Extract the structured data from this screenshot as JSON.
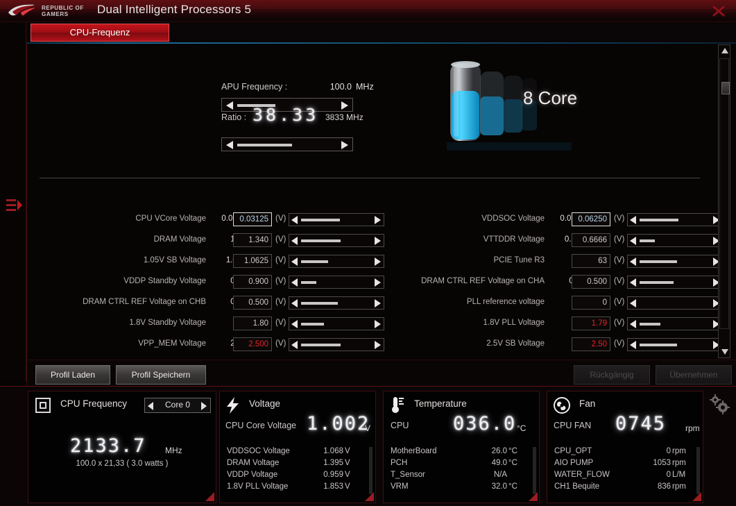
{
  "window": {
    "brand_line1": "REPUBLIC OF",
    "brand_line2": "GAMERS",
    "title": "Dual Intelligent Processors 5",
    "close_icon": "close-icon",
    "accent_red": "#b31118",
    "accent_cyan": "#1d6f9e"
  },
  "rail": {
    "toggle_icon": "menu-expand-icon"
  },
  "tabs": [
    {
      "label": "CPU-Frequenz",
      "active": true
    }
  ],
  "frequency": {
    "apu_label": "APU Frequency :",
    "apu_value": "100.0",
    "apu_unit": "MHz",
    "ratio_label": "Ratio :",
    "ratio_value": "38.33",
    "ratio_mhz": "3833 MHz",
    "apu_slider_fill_pct": 38,
    "ratio_slider_fill_pct": 54
  },
  "cores": {
    "count_label": "8 Core"
  },
  "voltage_rows_left": [
    {
      "name": "CPU VCore Voltage",
      "current": "0.03125",
      "value": "0.03125",
      "unit": "(V)",
      "focused": true,
      "red": false,
      "fill_pct": 52
    },
    {
      "name": "DRAM Voltage",
      "current": "1.340",
      "value": "1.340",
      "unit": "(V)",
      "focused": false,
      "red": false,
      "fill_pct": 53
    },
    {
      "name": "1.05V SB Voltage",
      "current": "1.0625",
      "value": "1.0625",
      "unit": "(V)",
      "focused": false,
      "red": false,
      "fill_pct": 36
    },
    {
      "name": "VDDP Standby Voltage",
      "current": "0.900",
      "value": "0.900",
      "unit": "(V)",
      "focused": false,
      "red": false,
      "fill_pct": 20
    },
    {
      "name": "DRAM CTRL REF Voltage on CHB",
      "current": "0.500",
      "value": "0.500",
      "unit": "(V)",
      "focused": false,
      "red": false,
      "fill_pct": 49
    },
    {
      "name": "1.8V Standby Voltage",
      "current": "1.80",
      "value": "1.80",
      "unit": "(V)",
      "focused": false,
      "red": false,
      "fill_pct": 31
    },
    {
      "name": "VPP_MEM Voltage",
      "current": "2.500",
      "value": "2.500",
      "unit": "(V)",
      "focused": false,
      "red": true,
      "fill_pct": 53
    }
  ],
  "voltage_rows_right": [
    {
      "name": "VDDSOC Voltage",
      "current": "0.06250",
      "value": "0.06250",
      "unit": "(V)",
      "focused": true,
      "red": false,
      "fill_pct": 52
    },
    {
      "name": "VTTDDR Voltage",
      "current": "0.6666",
      "value": "0.6666",
      "unit": "(V)",
      "focused": false,
      "red": false,
      "fill_pct": 20
    },
    {
      "name": "PCIE Tune R3",
      "current": "63",
      "value": "63",
      "unit": "(V)",
      "focused": false,
      "red": false,
      "fill_pct": 50
    },
    {
      "name": "DRAM CTRL REF Voltage on CHA",
      "current": "0.500",
      "value": "0.500",
      "unit": "(V)",
      "focused": false,
      "red": false,
      "fill_pct": 45
    },
    {
      "name": "PLL reference voltage",
      "current": "0",
      "value": "0",
      "unit": "(V)",
      "focused": false,
      "red": false,
      "fill_pct": 0
    },
    {
      "name": "1.8V PLL Voltage",
      "current": "1.79",
      "value": "1.79",
      "unit": "(V)",
      "focused": false,
      "red": true,
      "fill_pct": 28
    },
    {
      "name": "2.5V SB Voltage",
      "current": "2.50",
      "value": "2.50",
      "unit": "(V)",
      "focused": false,
      "red": true,
      "fill_pct": 50
    }
  ],
  "actions": {
    "load_profile": "Profil Laden",
    "save_profile": "Profil Speichern",
    "undo": "Rückgängig",
    "apply": "Übernehmen"
  },
  "monitor": {
    "cpu_frequency": {
      "icon": "cpu-icon",
      "title": "CPU Frequency",
      "core_select": "Core 0",
      "big_value": "2133.7",
      "big_unit": "MHz",
      "detail": "100.0  x 21,33 ( 3.0   watts )"
    },
    "voltage": {
      "icon": "bolt-icon",
      "title": "Voltage",
      "big_label": "CPU Core Voltage",
      "big_value": "1.002",
      "big_unit": "V",
      "items": [
        {
          "key": "VDDSOC Voltage",
          "value": "1.068",
          "unit": "V"
        },
        {
          "key": "DRAM Voltage",
          "value": "1.395",
          "unit": "V"
        },
        {
          "key": "VDDP Voltage",
          "value": "0.959",
          "unit": "V"
        },
        {
          "key": "1.8V PLL Voltage",
          "value": "1.853",
          "unit": "V"
        }
      ]
    },
    "temperature": {
      "icon": "thermometer-icon",
      "title": "Temperature",
      "big_label": "CPU",
      "big_value": "036.0",
      "big_unit": "°C",
      "items": [
        {
          "key": "MotherBoard",
          "value": "26.0",
          "unit": "°C"
        },
        {
          "key": "PCH",
          "value": "49.0",
          "unit": "°C"
        },
        {
          "key": "T_Sensor",
          "value": "N/A",
          "unit": ""
        },
        {
          "key": "VRM",
          "value": "32.0",
          "unit": "°C"
        }
      ]
    },
    "fan": {
      "icon": "fan-icon",
      "title": "Fan",
      "big_label": "CPU FAN",
      "big_value": "0745",
      "big_unit": "rpm",
      "items": [
        {
          "key": "CPU_OPT",
          "value": "0",
          "unit": "rpm"
        },
        {
          "key": "AIO PUMP",
          "value": "1053",
          "unit": "rpm"
        },
        {
          "key": "WATER_FLOW",
          "value": "0",
          "unit": "L/M"
        },
        {
          "key": "CH1 Bequite",
          "value": "836",
          "unit": "rpm"
        }
      ]
    },
    "settings_icon": "gears-icon"
  }
}
